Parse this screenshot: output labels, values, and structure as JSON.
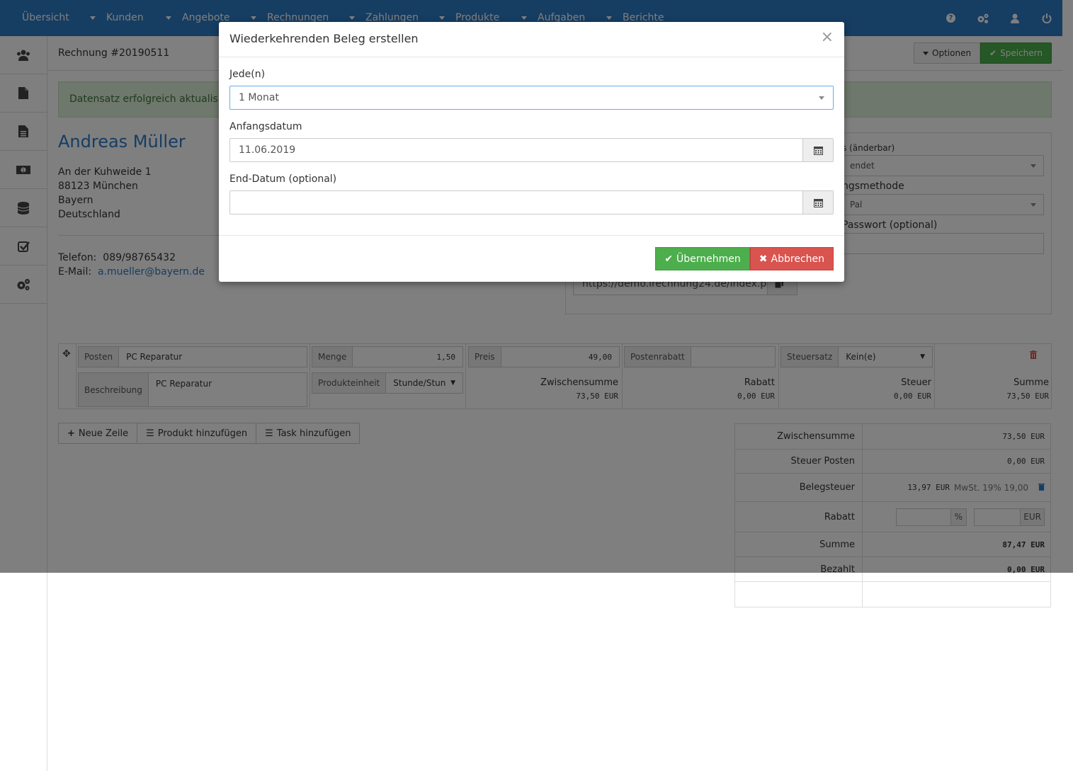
{
  "nav": {
    "items": [
      "Übersicht",
      "Kunden",
      "Angebote",
      "Rechnungen",
      "Zahlungen",
      "Produkte",
      "Aufgaben",
      "Berichte"
    ],
    "right_icons": [
      "help-icon",
      "cogs-icon",
      "user-icon",
      "power-icon"
    ]
  },
  "sidebar": {
    "items": [
      "users-icon",
      "file-icon",
      "file-text-icon",
      "money-icon",
      "database-icon",
      "check-square-icon",
      "cogs-icon"
    ]
  },
  "page": {
    "title": "Rechnung #20190511",
    "options_label": "Optionen",
    "save_label": "Speichern",
    "alert": "Datensatz erfolgreich aktualisiert."
  },
  "client": {
    "name": "Andreas Müller",
    "address": [
      "An der Kuhweide 1",
      "88123 München",
      "Bayern",
      "Deutschland"
    ],
    "phone_label": "Telefon:",
    "phone": "089/98765432",
    "email_label": "E-Mail:",
    "email": "a.mueller@bayern.de"
  },
  "invoice_meta": {
    "status_label": "s (änderbar)",
    "status_value": "endet",
    "payment_label": "ngsmethode",
    "payment_value": "Pal",
    "password_label": "Passwort (optional)",
    "link": "https://demo.irechnung24.de/index.p"
  },
  "item": {
    "posten_label": "Posten",
    "posten": "PC Reparatur",
    "menge_label": "Menge",
    "menge": "1,50",
    "preis_label": "Preis",
    "preis": "49,00",
    "rabatt_label": "Postenrabatt",
    "steuer_label": "Steuersatz",
    "steuer": "Kein(e)",
    "beschreibung_label": "Beschreibung",
    "beschreibung": "PC Reparatur",
    "einheit_label": "Produkteinheit",
    "einheit": "Stunde/Stun",
    "zwischensumme_label": "Zwischensumme",
    "zwischensumme": "73,50 EUR",
    "rabatt2_label": "Rabatt",
    "rabatt2": "0,00 EUR",
    "steuer2_label": "Steuer",
    "steuer2": "0,00 EUR",
    "summe_label": "Summe",
    "summe": "73,50 EUR"
  },
  "actions": {
    "new_row": "Neue Zeile",
    "add_product": "Produkt hinzufügen",
    "add_task": "Task hinzufügen"
  },
  "totals": {
    "zwischensumme_label": "Zwischensumme",
    "zwischensumme": "73,50 EUR",
    "steuer_posten_label": "Steuer Posten",
    "steuer_posten": "0,00 EUR",
    "belegsteuer_label": "Belegsteuer",
    "belegsteuer": "13,97 EUR",
    "belegsteuer_desc": "MwSt. 19% 19,00",
    "rabatt_label": "Rabatt",
    "rabatt_pct": "%",
    "rabatt_eur": "EUR",
    "summe_label": "Summe",
    "summe": "87,47 EUR",
    "bezahlt_label": "Bezahlt",
    "bezahlt": "0,00 EUR"
  },
  "modal": {
    "title": "Wiederkehrenden Beleg erstellen",
    "close": "×",
    "every_label": "Jede(n)",
    "every_value": "1 Monat",
    "start_label": "Anfangsdatum",
    "start_value": "11.06.2019",
    "end_label": "End-Datum (optional)",
    "end_value": "",
    "apply_label": "Übernehmen",
    "cancel_label": "Abbrechen"
  },
  "colors": {
    "nav": "#2c7bc4",
    "success": "#4cae4c",
    "danger": "#d9534f"
  }
}
